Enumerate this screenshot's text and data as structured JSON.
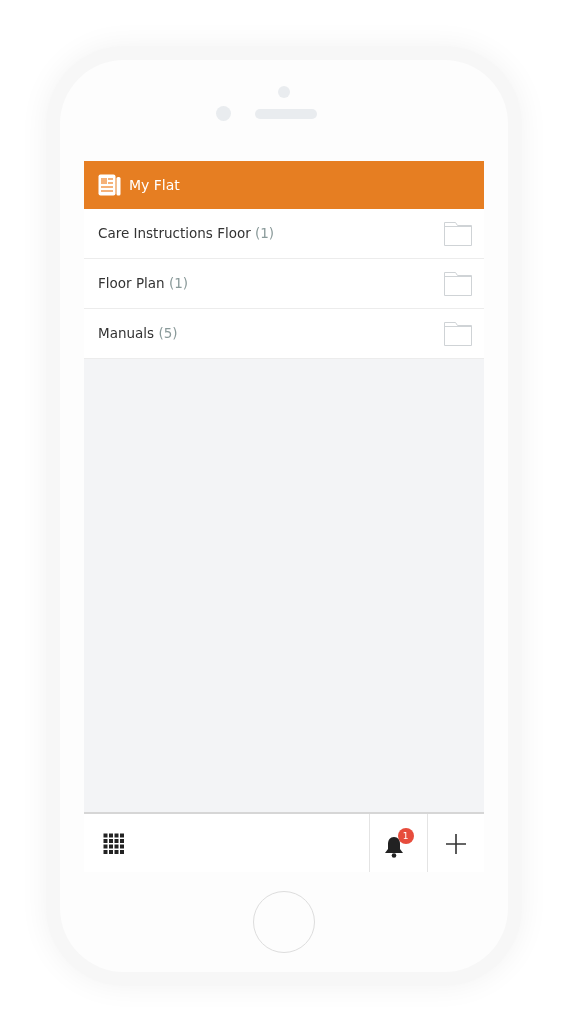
{
  "header": {
    "title": "My Flat"
  },
  "folders": [
    {
      "name": "Care Instructions Floor",
      "count": "(1)"
    },
    {
      "name": "Floor Plan",
      "count": "(1)"
    },
    {
      "name": "Manuals",
      "count": "(5)"
    }
  ],
  "toolbar": {
    "notification_count": "1"
  }
}
